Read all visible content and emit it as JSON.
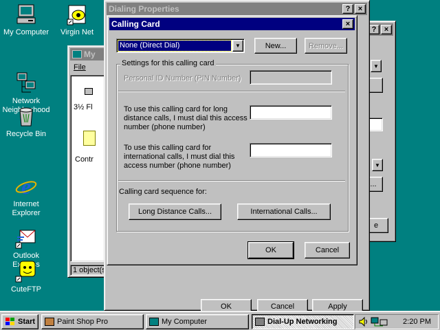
{
  "desktop": {
    "icons": [
      {
        "label": "My Computer"
      },
      {
        "label": "Virgin Net"
      },
      {
        "label": "Network\nNeighborhood"
      },
      {
        "label": "Recycle Bin"
      },
      {
        "label": "Internet\nExplorer"
      },
      {
        "label": "Outlook\nExpress"
      },
      {
        "label": "CuteFTP"
      }
    ]
  },
  "mycomputer_window": {
    "title": "My",
    "menu_file": "File",
    "item1": "3½ Fl",
    "item2": "Contr",
    "status": "1 object(s"
  },
  "dialing_properties": {
    "title": "Dialing Properties",
    "help": "?",
    "close": "×",
    "ok": "OK",
    "cancel": "Cancel",
    "apply": "Apply"
  },
  "background_dialog": {
    "help": "?",
    "close": "×"
  },
  "calling_card": {
    "title": "Calling Card",
    "close": "×",
    "dropdown_value": "None (Direct Dial)",
    "new_button": "New...",
    "remove_button": "Remove...",
    "group_label": "Settings for this calling card",
    "pin_label": "Personal ID Number (PIN Number)",
    "long_distance_label": "To use this calling card for long distance calls, I must dial this access number (phone number)",
    "international_label": "To use this calling card for international calls, I must dial this access number (phone number)",
    "sequence_label": "Calling card sequence for:",
    "long_distance_button": "Long Distance Calls...",
    "international_button": "International Calls...",
    "ok": "OK",
    "cancel": "Cancel"
  },
  "taskbar": {
    "start": "Start",
    "tasks": [
      {
        "label": "Paint Shop Pro"
      },
      {
        "label": "My Computer"
      },
      {
        "label": "Dial-Up Networking"
      }
    ],
    "clock": "2:20 PM"
  }
}
